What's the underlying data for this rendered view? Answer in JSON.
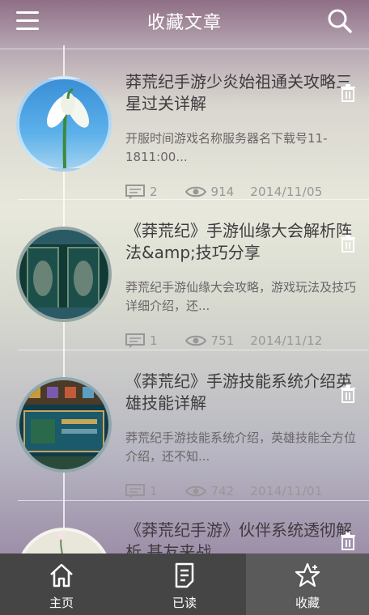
{
  "header": {
    "title": "收藏文章",
    "menu_icon": "menu-icon",
    "search_icon": "search-icon"
  },
  "articles": [
    {
      "title": "莽荒纪手游少炎始祖通关攻略三星过关详解",
      "summary": "开服时间游戏名称服务器名下载号11-1811:00...",
      "comments": "2",
      "views": "914",
      "date": "2014/11/05",
      "thumb": "snowdrop-flower"
    },
    {
      "title": "《莽荒纪》手游仙缘大会解析阵法&amp;技巧分享",
      "summary": "莽荒纪手游仙缘大会攻略，游戏玩法及技巧详细介绍，还...",
      "comments": "1",
      "views": "751",
      "date": "2014/11/12",
      "thumb": "game-screenshot-formation"
    },
    {
      "title": "《莽荒纪》手游技能系统介绍英雄技能详解",
      "summary": "莽荒纪手游技能系统介绍，英雄技能全方位介绍，还不知...",
      "comments": "1",
      "views": "742",
      "date": "2014/11/01",
      "thumb": "game-screenshot-skills"
    },
    {
      "title": "《莽荒纪手游》伙伴系统透彻解析 基友来战",
      "thumb": "flower"
    }
  ],
  "tabbar": {
    "tabs": [
      {
        "label": "主页",
        "icon": "home-icon"
      },
      {
        "label": "已读",
        "icon": "document-icon"
      },
      {
        "label": "收藏",
        "icon": "star-icon",
        "active": true
      }
    ]
  },
  "colors": {
    "tabbar_bg": "#454545",
    "tab_active_bg": "#5a5a5a",
    "title_text": "#3f3b3e",
    "meta_text": "#9a9597"
  }
}
